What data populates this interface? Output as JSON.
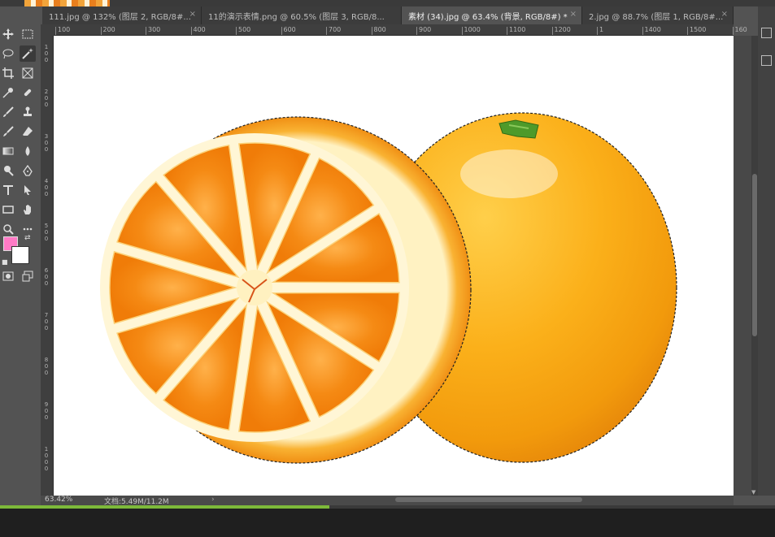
{
  "tabs": [
    {
      "label": "111.jpg @ 132% (图层 2, RGB/8#...",
      "active": false
    },
    {
      "label": "11的演示表情.png @ 60.5% (图层 3, RGB/8...",
      "active": false
    },
    {
      "label": "素材 (34).jpg @ 63.4% (背景, RGB/8#) *",
      "active": true
    },
    {
      "label": "2.jpg @ 88.7% (图层 1, RGB/8#...",
      "active": false
    }
  ],
  "tab_close_glyph": "×",
  "ruler_top_labels": [
    "100",
    "200",
    "300",
    "400",
    "500",
    "600",
    "700",
    "800",
    "900",
    "1000",
    "1100",
    "1200",
    "1",
    "1400",
    "1500",
    "160"
  ],
  "ruler_left_labels": [
    "100",
    "200",
    "300",
    "400",
    "500",
    "600",
    "700",
    "800",
    "900",
    "1000"
  ],
  "tools": [
    {
      "name": "move-tool-icon"
    },
    {
      "name": "marquee-tool-icon"
    },
    {
      "name": "lasso-tool-icon"
    },
    {
      "name": "magic-wand-tool-icon"
    },
    {
      "name": "crop-tool-icon"
    },
    {
      "name": "frame-tool-icon"
    },
    {
      "name": "eyedropper-tool-icon"
    },
    {
      "name": "healing-brush-tool-icon"
    },
    {
      "name": "brush-tool-icon"
    },
    {
      "name": "clone-stamp-tool-icon"
    },
    {
      "name": "history-brush-tool-icon"
    },
    {
      "name": "eraser-tool-icon"
    },
    {
      "name": "gradient-tool-icon"
    },
    {
      "name": "blur-tool-icon"
    },
    {
      "name": "dodge-tool-icon"
    },
    {
      "name": "pen-tool-icon"
    },
    {
      "name": "type-tool-icon"
    },
    {
      "name": "path-selection-tool-icon"
    },
    {
      "name": "rectangle-tool-icon"
    },
    {
      "name": "hand-tool-icon"
    },
    {
      "name": "zoom-tool-icon"
    },
    {
      "name": "more-tools-icon"
    }
  ],
  "colors": {
    "foreground": "#ff7ac6",
    "background": "#ffffff",
    "accent_progress": "#7db93a"
  },
  "status": {
    "zoom": "63.42%",
    "doc": "文档:5.49M/11.2M",
    "arrow": "›"
  },
  "progress": {
    "fraction": 0.425
  }
}
